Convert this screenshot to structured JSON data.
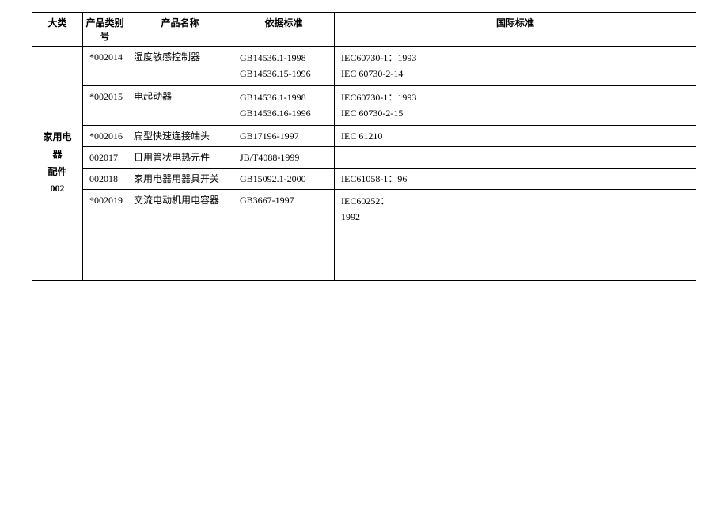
{
  "headers": {
    "category": "大类",
    "prodnum": "产品类别号",
    "prodname": "产品名称",
    "basis": "依据标准",
    "intl": "国际标准"
  },
  "categoryLabel": "家用电器\n配件\n002",
  "rows": [
    {
      "prodnum": "*002014",
      "prodname": "湿度敏感控制器",
      "basis": "GB14536.1-1998\nGB14536.15-1996",
      "intl": "IEC60730-1：1993\nIEC 60730-2-14"
    },
    {
      "prodnum": "*002015",
      "prodname": "电起动器",
      "basis": "GB14536.1-1998\nGB14536.16-1996",
      "intl": "IEC60730-1：1993\nIEC 60730-2-15"
    },
    {
      "prodnum": "*002016",
      "prodname": "扁型快速连接端头",
      "basis": "GB17196-1997",
      "intl": "IEC 61210"
    },
    {
      "prodnum": "002017",
      "prodname": "日用管状电热元件",
      "basis": "JB/T4088-1999",
      "intl": ""
    },
    {
      "prodnum": "002018",
      "prodname": "家用电器用器具开关",
      "basis": "GB15092.1-2000",
      "intl": "IEC61058-1：96"
    },
    {
      "prodnum": "*002019",
      "prodname": "交流电动机用电容器",
      "basis": "GB3667-1997",
      "intl": "IEC60252：\n1992"
    }
  ]
}
